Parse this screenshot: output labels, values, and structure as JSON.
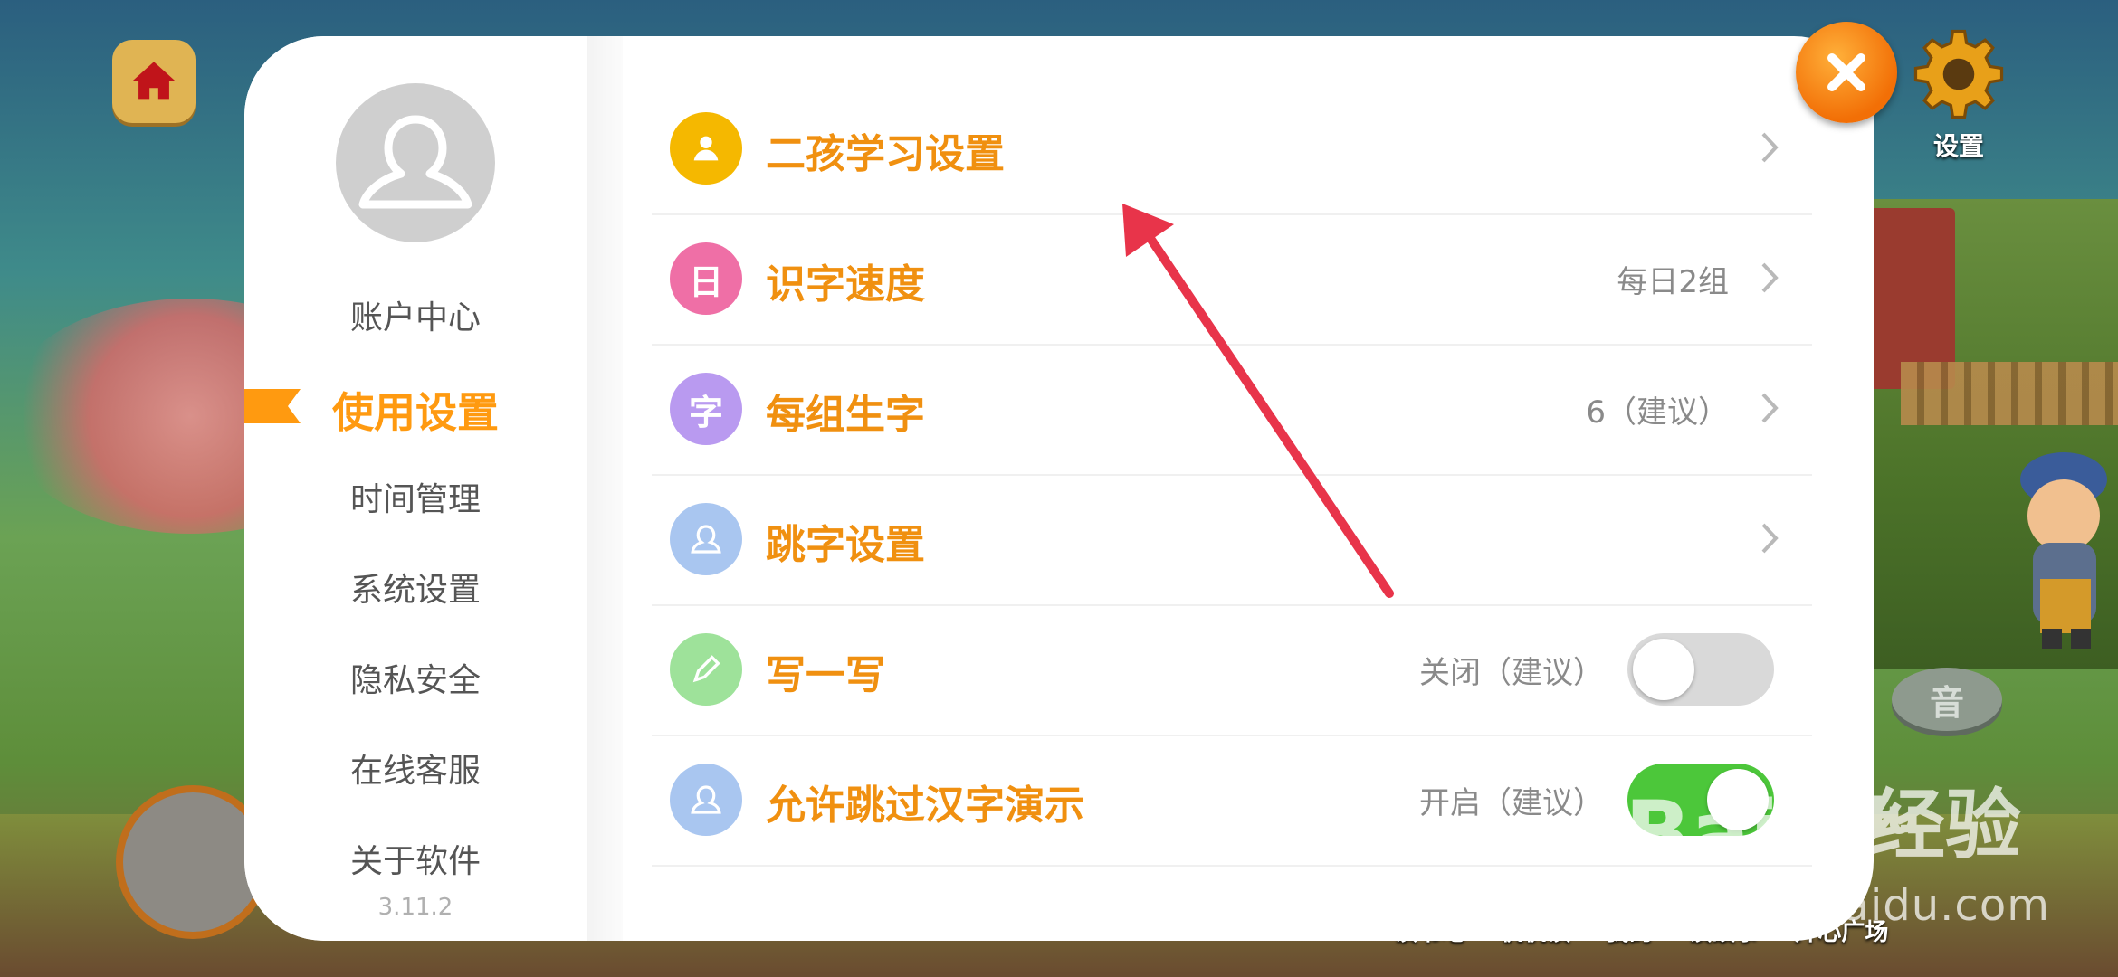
{
  "background": {
    "settings_label": "设置",
    "sound_label": "音",
    "bottom_nav": [
      "读书吧",
      "帆帆读",
      "我的",
      "读故事",
      "开心广场"
    ]
  },
  "sidebar": {
    "items": [
      {
        "label": "账户中心"
      },
      {
        "label": "使用设置",
        "active": true
      },
      {
        "label": "时间管理"
      },
      {
        "label": "系统设置"
      },
      {
        "label": "隐私安全"
      },
      {
        "label": "在线客服"
      },
      {
        "label": "关于软件"
      }
    ],
    "version": "3.11.2"
  },
  "settings": [
    {
      "label": "二孩学习设置",
      "value": "",
      "icon": "person-icon",
      "color": "#f5b800",
      "control": "chevron"
    },
    {
      "label": "识字速度",
      "value": "每日2组",
      "icon": "calendar-icon",
      "glyph": "日",
      "color": "#ef6fa6",
      "control": "chevron"
    },
    {
      "label": "每组生字",
      "value": "6（建议）",
      "icon": "character-icon",
      "glyph": "字",
      "color": "#b99af0",
      "control": "chevron"
    },
    {
      "label": "跳字设置",
      "value": "",
      "icon": "person-outline-icon",
      "color": "#a9c6f0",
      "control": "chevron"
    },
    {
      "label": "写一写",
      "value": "关闭（建议）",
      "icon": "pen-icon",
      "color": "#9ee29a",
      "control": "toggle",
      "on": false
    },
    {
      "label": "允许跳过汉字演示",
      "value": "开启（建议）",
      "icon": "person-outline-icon",
      "color": "#a9c6f0",
      "control": "toggle",
      "on": true
    }
  ],
  "watermark": {
    "brand_a": "Bai",
    "brand_b": "du",
    "brand_c": "经验",
    "url": "jingyan.baidu.com"
  },
  "colors": {
    "accent": "#ff9a10",
    "close": "#f26f06",
    "toggle_on": "#4cc73a",
    "toggle_off": "#d9d9d9",
    "arrow": "#e8344a"
  }
}
